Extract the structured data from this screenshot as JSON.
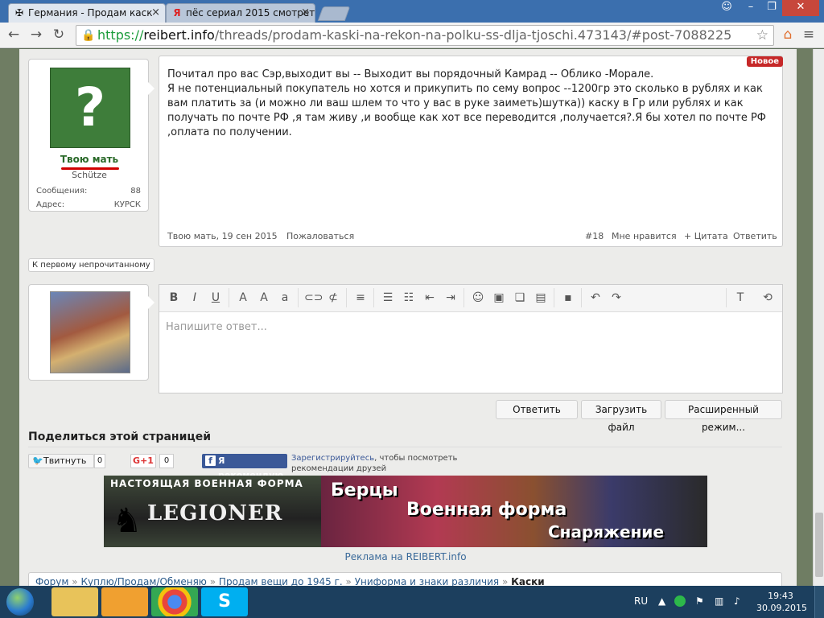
{
  "browser": {
    "tabs": [
      {
        "title": "Германия - Продам каск",
        "icon": "iron-cross-icon",
        "active": true
      },
      {
        "title": "пёс сериал 2015 смотрет",
        "icon": "yandex-icon",
        "active": false
      }
    ],
    "url": {
      "scheme": "https://",
      "host": "reibert.info",
      "path": "/threads/prodam-kaski-na-rekon-na-polku-ss-dlja-tjoschi.473143/#post-7088225"
    }
  },
  "post": {
    "badge": "Новое",
    "body": "Почитал про вас Сэр,выходит вы -- Выходит вы порядочный Камрад -- Облико -Морале.\nЯ не потенциальный покупатель но хотся и прикупить по сему вопрос --1200гр это сколько в рублях и как вам платить за (и можно ли ваш шлем то что у вас в руке заиметь)шутка)) каску в Гр или рублях и как получать по почте РФ ,я там живу ,и вообще как хот все переводится ,получается?.Я бы хотел по почте РФ ,оплата по получении.",
    "author_date": "Твою мать, 19 сен 2015",
    "report": "Пожаловаться",
    "number": "#18",
    "like": "Мне нравится",
    "quote": "+ Цитата",
    "reply": "Ответить"
  },
  "author": {
    "name": "Твою мать",
    "rank": "Schütze",
    "messages_label": "Сообщения:",
    "messages_value": "88",
    "address_label": "Адрес:",
    "address_value": "КУРСК"
  },
  "first_unread": "К первому непрочитанному",
  "editor": {
    "placeholder": "Напишите ответ...",
    "reply_button": "Ответить",
    "upload_button": "Загрузить файл",
    "advanced_button": "Расширенный режим..."
  },
  "share": {
    "title": "Поделиться этой страницей",
    "tweet": "Твитнуть",
    "tweet_count": "0",
    "gplus": "G+1",
    "gplus_count": "0",
    "fb": "Я рекомендую",
    "register_link": "Зарегистрируйтесь",
    "register_text": ", чтобы посмотреть рекомендации друзей"
  },
  "banner": {
    "top": "НАСТОЯЩАЯ ВОЕННАЯ ФОРМА",
    "brand": "LEGIONER",
    "line1": "Берцы",
    "line2": "Военная форма",
    "line3": "Снаряжение",
    "caption": "Реклама на REIBERT.info"
  },
  "breadcrumb": [
    "Форум",
    "Куплю/Продам/Обменяю",
    "Продам вещи до 1945 г.",
    "Униформа и знаки различия",
    "Каски"
  ],
  "taskbar": {
    "lang": "RU",
    "time": "19:43",
    "date": "30.09.2015"
  }
}
